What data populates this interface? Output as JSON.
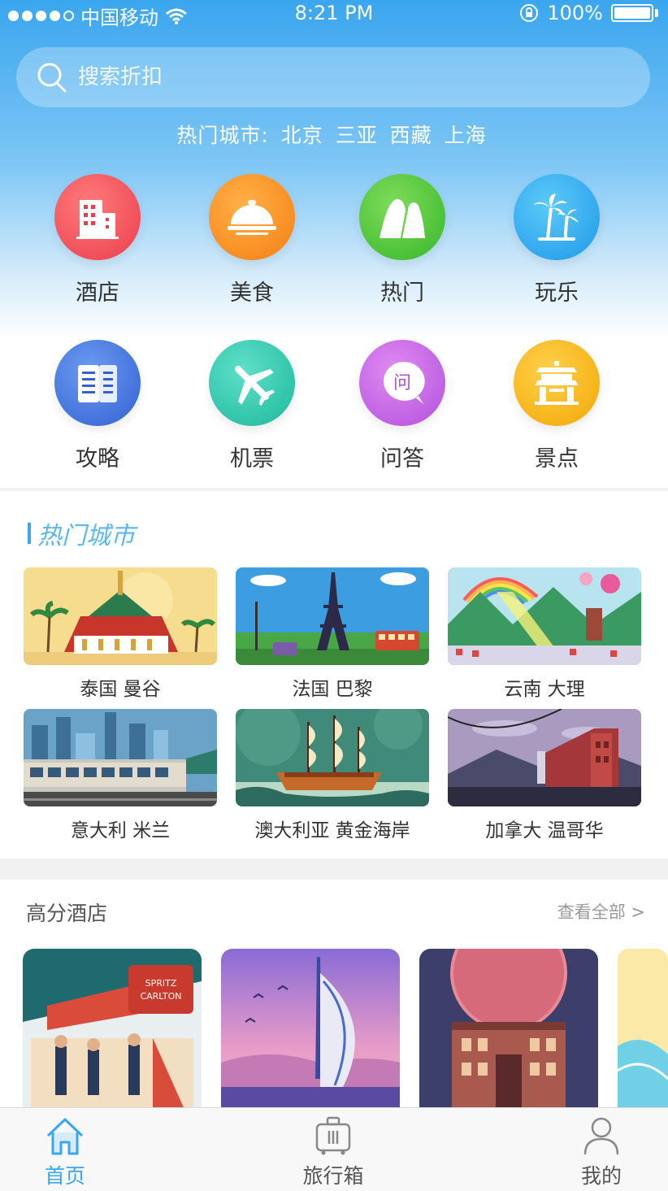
{
  "status_bar": {
    "carrier": "中国移动",
    "time": "8:21 PM",
    "battery": "100%"
  },
  "search": {
    "placeholder": "搜索折扣"
  },
  "hot_cities": {
    "label": "热门城市:",
    "cities": [
      "北京",
      "三亚",
      "西藏",
      "上海"
    ]
  },
  "categories": [
    {
      "label": "酒店",
      "icon": "hotel-icon",
      "color": "#f0505a"
    },
    {
      "label": "美食",
      "icon": "food-cloche-icon",
      "color": "#f98c1e"
    },
    {
      "label": "热门",
      "icon": "mountain-icon",
      "color": "#4fc93a"
    },
    {
      "label": "玩乐",
      "icon": "palm-tree-icon",
      "color": "#2aa9ef"
    },
    {
      "label": "攻略",
      "icon": "guide-book-icon",
      "color": "#3e72e0"
    },
    {
      "label": "机票",
      "icon": "airplane-icon",
      "color": "#26cbb0"
    },
    {
      "label": "问答",
      "icon": "qa-bubble-icon",
      "color": "#c262e6"
    },
    {
      "label": "景点",
      "icon": "pavilion-icon",
      "color": "#f7b414"
    }
  ],
  "qa_icon_glyph": "问",
  "hot_city_section": {
    "title": "热门城市",
    "cities": [
      {
        "name": "泰国 曼谷"
      },
      {
        "name": "法国 巴黎"
      },
      {
        "name": "云南 大理"
      },
      {
        "name": "意大利 米兰"
      },
      {
        "name": "澳大利亚 黄金海岸"
      },
      {
        "name": "加拿大 温哥华"
      }
    ]
  },
  "hotels": {
    "title": "高分酒店",
    "more": "查看全部 >"
  },
  "hotel_sign": [
    "SPRITZ",
    "CARLTON"
  ],
  "tabs": [
    {
      "label": "首页",
      "icon": "home-icon",
      "active": true
    },
    {
      "label": "旅行箱",
      "icon": "suitcase-icon",
      "active": false
    },
    {
      "label": "我的",
      "icon": "user-icon",
      "active": false
    }
  ],
  "colors": {
    "accent": "#3aa6ee",
    "tab_active": "#3aa6ee"
  }
}
